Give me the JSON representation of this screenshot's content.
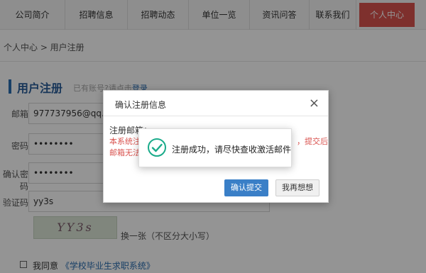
{
  "nav": {
    "items": [
      "公司简介",
      "招聘信息",
      "招聘动态",
      "单位一览",
      "资讯问答",
      "联系我们",
      "个人中心"
    ]
  },
  "breadcrumb": "个人中心 > 用户注册",
  "section": {
    "title": "用户注册",
    "sub_prefix": "已有账号?请点击",
    "sub_link": "登录"
  },
  "form": {
    "email_label": "邮箱",
    "email_value": "977737956@qq.co",
    "password_label": "密码",
    "password_value": "••••••••",
    "confirm_label": "确认密码",
    "confirm_value": "••••••••",
    "captcha_label": "验证码",
    "captcha_value": "yy3s",
    "captcha_image_text": "YY3s",
    "captcha_hint": "换一张（不区分大小写）",
    "agree_text": "我同意",
    "agree_link": "《学校毕业生求职系统》"
  },
  "dialog": {
    "title": "确认注册信息",
    "close": "×",
    "line1": "注册邮箱：",
    "line2": "本系统注",
    "line2b": "，提交后",
    "line3": "邮箱无法",
    "confirm_button": "确认提交",
    "cancel_button": "我再想想"
  },
  "toast": {
    "message": "注册成功，请尽快查收激活邮件",
    "icon": "check-circle-icon",
    "icon_color": "#1aab8a"
  },
  "colors": {
    "accent": "#d9534f",
    "primary": "#3a7fc7"
  }
}
